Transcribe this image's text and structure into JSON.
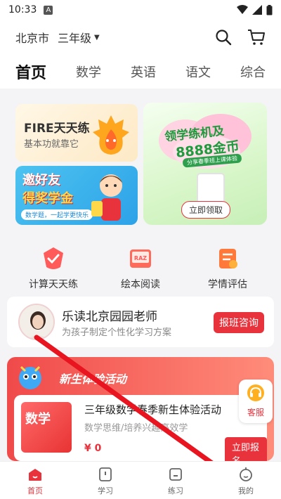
{
  "status_bar": {
    "time": "10:33",
    "app_icon_letter": "A"
  },
  "topbar": {
    "location": "北京市",
    "grade": "三年级"
  },
  "tabs": [
    "首页",
    "数学",
    "英语",
    "语文",
    "综合"
  ],
  "banners": {
    "fire": {
      "title": "FIRE天天练",
      "subtitle": "基本功就靠它"
    },
    "invite": {
      "line1": "邀好友",
      "line2": "得奖学金",
      "pill": "数学题，一起学更快乐"
    },
    "promo": {
      "line1": "领学练机及",
      "line2": "8888金币",
      "line3": "分享春季班上课体验",
      "button": "立即领取"
    }
  },
  "shortcuts": [
    {
      "label": "计算天天练",
      "icon": "check-shield-icon"
    },
    {
      "label": "绘本阅读",
      "icon": "raz-book-icon"
    },
    {
      "label": "学情评估",
      "icon": "report-icon"
    }
  ],
  "teacher": {
    "name": "乐读北京园园老师",
    "subtitle": "为孩子制定个性化学习方案",
    "button": "报班咨询"
  },
  "activity": {
    "title": "新生体验活动",
    "thumb_label": "数学",
    "course_title": "三年级数学春季新生体验活动",
    "course_desc": "数学思维/培养兴趣高效学",
    "price": "¥ 0",
    "button": "立即报名"
  },
  "kefu": {
    "label": "客服"
  },
  "bottom_nav": [
    {
      "label": "首页",
      "active": true
    },
    {
      "label": "学习",
      "active": false
    },
    {
      "label": "练习",
      "active": false
    },
    {
      "label": "我的",
      "active": false
    }
  ],
  "colors": {
    "accent": "#e8333d",
    "promo_green": "#1e9b3c",
    "invite_blue": "#2da2e8"
  }
}
